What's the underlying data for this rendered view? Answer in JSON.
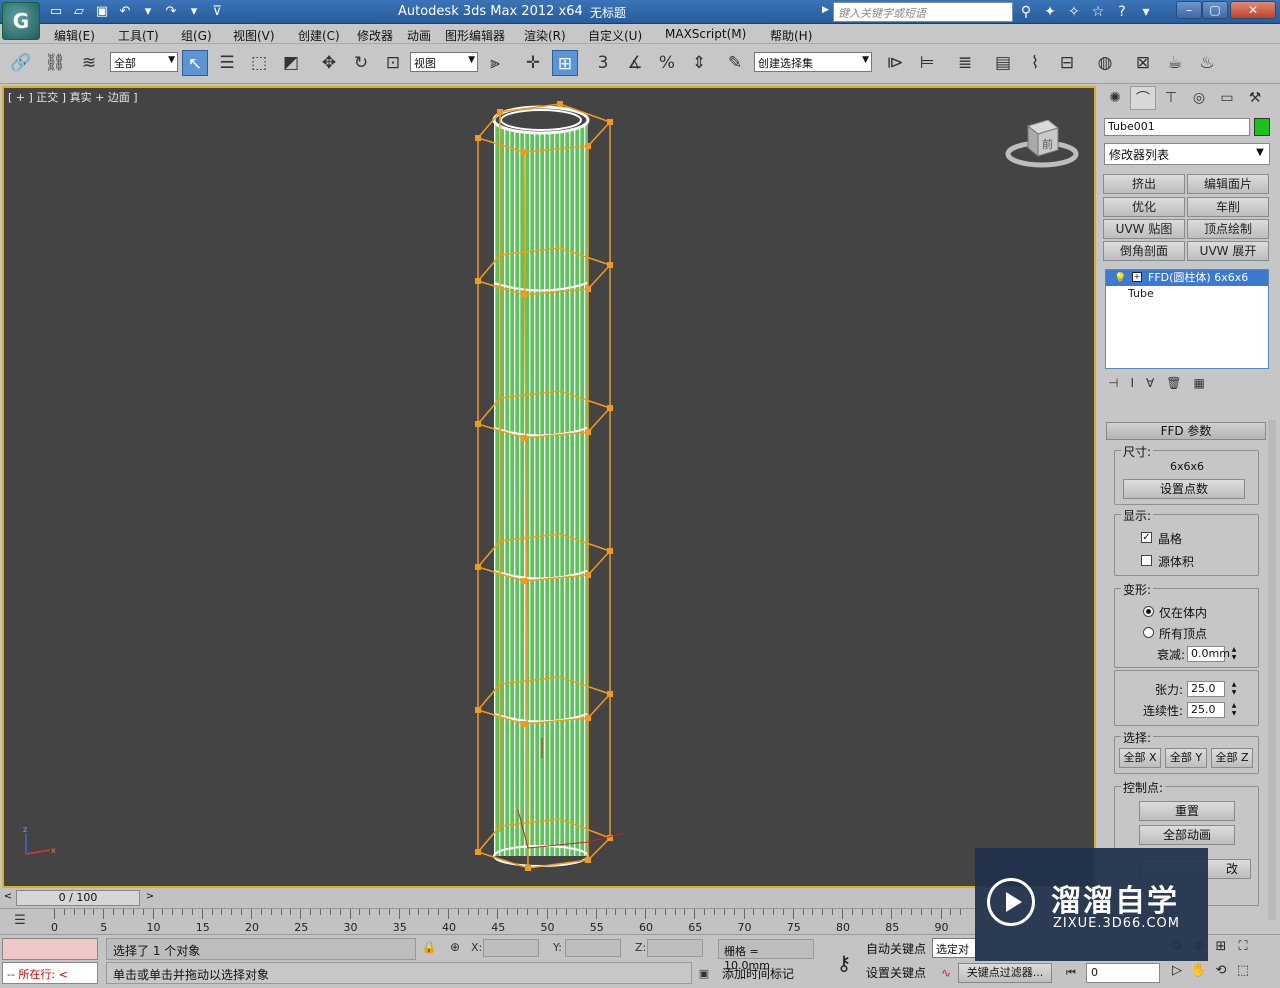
{
  "titlebar": {
    "app_title": "Autodesk 3ds Max  2012 x64",
    "doc_title": "无标题",
    "search_placeholder": "键入关键字或短语"
  },
  "menubar": {
    "items": [
      "编辑(E)",
      "工具(T)",
      "组(G)",
      "视图(V)",
      "创建(C)",
      "修改器",
      "动画",
      "图形编辑器",
      "渲染(R)",
      "自定义(U)",
      "MAXScript(M)",
      "帮助(H)"
    ]
  },
  "toolbar": {
    "selection_filter": "全部",
    "ref_coord": "视图",
    "snap_label": "3",
    "named_selection": "创建选择集"
  },
  "viewport": {
    "label": "[ + ] 正交 ] 真实 + 边面 ]",
    "viewcube_face": "前",
    "axis_x": "x",
    "axis_z": "z"
  },
  "command_panel": {
    "object_name": "Tube001",
    "object_color": "#18c418",
    "modifier_list": "修改器列表",
    "modifier_buttons": [
      "挤出",
      "编辑面片",
      "优化",
      "车削",
      "UVW 贴图",
      "顶点绘制",
      "倒角剖面",
      "UVW 展开"
    ],
    "stack": {
      "top_item": "FFD(圆柱体) 6x6x6",
      "base_item": "Tube"
    },
    "ffd_params": {
      "header": "FFD 参数",
      "size_group": "尺寸:",
      "size_value": "6x6x6",
      "set_points": "设置点数",
      "display_group": "显示:",
      "lattice": "晶格",
      "lattice_checked": true,
      "source_volume": "源体积",
      "source_volume_checked": false,
      "deform_group": "变形:",
      "only_in_volume": "仅在体内",
      "all_vertices": "所有顶点",
      "falloff_label": "衰减:",
      "falloff_value": "0.0mm",
      "tension_label": "张力:",
      "tension_value": "25.0",
      "continuity_label": "连续性:",
      "continuity_value": "25.0",
      "select_group": "选择:",
      "all_x": "全部 X",
      "all_y": "全部 Y",
      "all_z": "全部 Z",
      "control_points_group": "控制点:",
      "reset": "重置",
      "animate_all": "全部动画",
      "partial_button_text": "改"
    }
  },
  "timeline": {
    "frame_display": "0 / 100",
    "ticks": [
      "0",
      "5",
      "10",
      "15",
      "20",
      "25",
      "30",
      "35",
      "40",
      "45",
      "50",
      "55",
      "60",
      "65",
      "70",
      "75",
      "80",
      "85",
      "90"
    ]
  },
  "statusbar": {
    "listener_text": "--  所在行:  <",
    "selection_status": "选择了 1 个对象",
    "prompt": "单击或单击并拖动以选择对象",
    "x_label": "X:",
    "y_label": "Y:",
    "z_label": "Z:",
    "grid": "栅格 = 10.0mm",
    "add_time_tag": "添加时间标记",
    "auto_key": "自动关键点",
    "set_key": "设置关键点",
    "selected_dropdown": "选定对",
    "key_filters": "关键点过滤器...",
    "current_frame": "0"
  },
  "watermark": {
    "brand": "溜溜自学",
    "url": "ZIXUE.3D66.COM"
  }
}
